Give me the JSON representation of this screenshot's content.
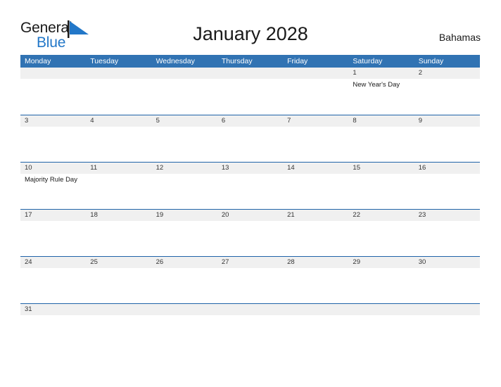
{
  "brand": {
    "line1": "General",
    "line2": "Blue",
    "flag_icon": "blue-flag-triangle",
    "flag_color": "#2277c8"
  },
  "header": {
    "title": "January 2028",
    "locale": "Bahamas"
  },
  "colors": {
    "header_blue": "#3173b3",
    "rule_blue": "#1f63a8",
    "number_band_gray": "#f0f0f0",
    "brand_blue": "#2277c8",
    "text_dark": "#1a1a1a"
  },
  "calendar": {
    "weekdays": [
      "Monday",
      "Tuesday",
      "Wednesday",
      "Thursday",
      "Friday",
      "Saturday",
      "Sunday"
    ],
    "weeks": [
      {
        "days": [
          {
            "number": "",
            "event": ""
          },
          {
            "number": "",
            "event": ""
          },
          {
            "number": "",
            "event": ""
          },
          {
            "number": "",
            "event": ""
          },
          {
            "number": "",
            "event": ""
          },
          {
            "number": "1",
            "event": "New Year's Day"
          },
          {
            "number": "2",
            "event": ""
          }
        ]
      },
      {
        "days": [
          {
            "number": "3",
            "event": ""
          },
          {
            "number": "4",
            "event": ""
          },
          {
            "number": "5",
            "event": ""
          },
          {
            "number": "6",
            "event": ""
          },
          {
            "number": "7",
            "event": ""
          },
          {
            "number": "8",
            "event": ""
          },
          {
            "number": "9",
            "event": ""
          }
        ]
      },
      {
        "days": [
          {
            "number": "10",
            "event": "Majority Rule Day"
          },
          {
            "number": "11",
            "event": ""
          },
          {
            "number": "12",
            "event": ""
          },
          {
            "number": "13",
            "event": ""
          },
          {
            "number": "14",
            "event": ""
          },
          {
            "number": "15",
            "event": ""
          },
          {
            "number": "16",
            "event": ""
          }
        ]
      },
      {
        "days": [
          {
            "number": "17",
            "event": ""
          },
          {
            "number": "18",
            "event": ""
          },
          {
            "number": "19",
            "event": ""
          },
          {
            "number": "20",
            "event": ""
          },
          {
            "number": "21",
            "event": ""
          },
          {
            "number": "22",
            "event": ""
          },
          {
            "number": "23",
            "event": ""
          }
        ]
      },
      {
        "days": [
          {
            "number": "24",
            "event": ""
          },
          {
            "number": "25",
            "event": ""
          },
          {
            "number": "26",
            "event": ""
          },
          {
            "number": "27",
            "event": ""
          },
          {
            "number": "28",
            "event": ""
          },
          {
            "number": "29",
            "event": ""
          },
          {
            "number": "30",
            "event": ""
          }
        ]
      },
      {
        "days": [
          {
            "number": "31",
            "event": ""
          },
          {
            "number": "",
            "event": ""
          },
          {
            "number": "",
            "event": ""
          },
          {
            "number": "",
            "event": ""
          },
          {
            "number": "",
            "event": ""
          },
          {
            "number": "",
            "event": ""
          },
          {
            "number": "",
            "event": ""
          }
        ]
      }
    ]
  }
}
